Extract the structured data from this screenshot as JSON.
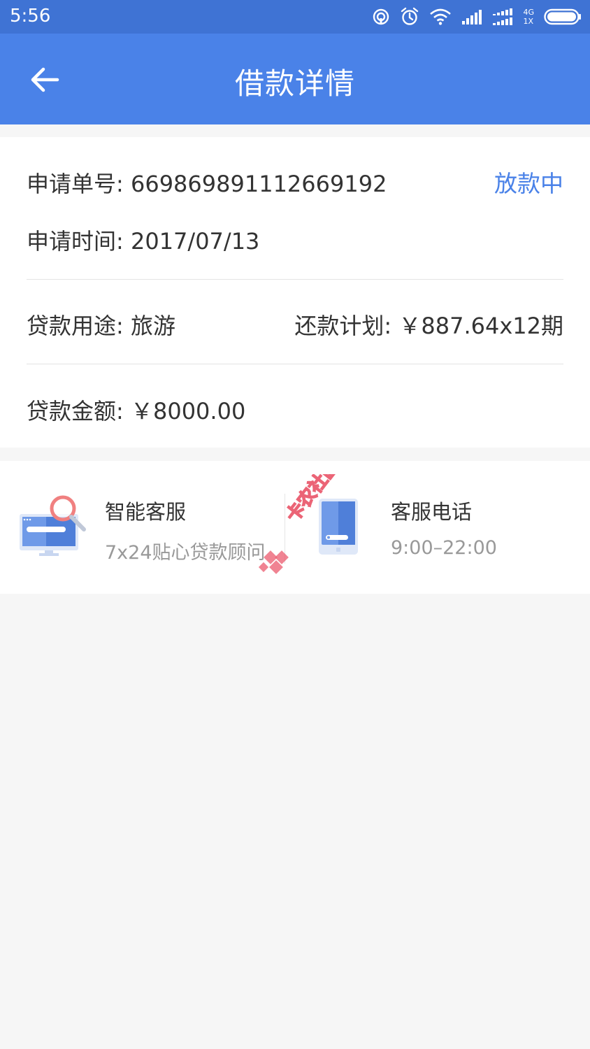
{
  "status_bar": {
    "time": "5:56",
    "network_top": "4G",
    "network_bottom": "1X",
    "icons": [
      "hotspot-icon",
      "alarm-icon",
      "wifi-icon",
      "signal-icon",
      "battery-icon"
    ]
  },
  "header": {
    "title": "借款详情",
    "back_icon": "arrow-left-icon"
  },
  "details": {
    "application_no_label": "申请单号:",
    "application_no": "669869891112669192",
    "status": "放款中",
    "application_time_label": "申请时间:",
    "application_time": "2017/07/13",
    "purpose_label": "贷款用途:",
    "purpose": "旅游",
    "repayment_label": "还款计划:",
    "repayment": "￥887.64x12期",
    "amount_label": "贷款金额:",
    "amount": "￥8000.00"
  },
  "services": {
    "smart": {
      "title": "智能客服",
      "subtitle": "7x24贴心贷款顾问",
      "icon": "monitor-search-icon"
    },
    "phone": {
      "title": "客服电话",
      "subtitle": "9:00–22:00",
      "icon": "phone-icon"
    }
  },
  "watermark": {
    "text": "卡农社区"
  },
  "colors": {
    "status_bar": "#3f73d4",
    "app_bar": "#4a82e8",
    "accent": "#4a82e8",
    "background": "#f6f6f6",
    "watermark": "#e84a5f"
  }
}
